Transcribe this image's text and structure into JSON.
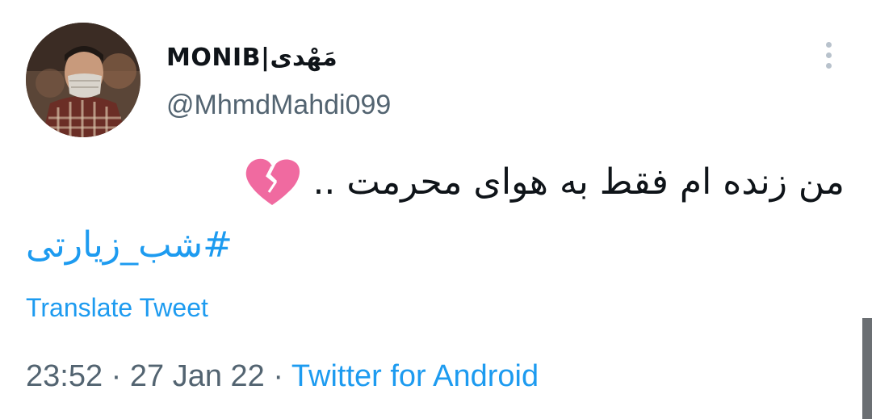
{
  "user": {
    "display_name": "MONIB|مَهْدی",
    "handle": "@MhmdMahdi099"
  },
  "tweet": {
    "text": "من زنده ام فقط به هوای محرمت ..",
    "heart_emoji": "broken-heart-icon",
    "hashtag": "#شب_زیارتی"
  },
  "actions": {
    "translate_label": "Translate Tweet"
  },
  "meta": {
    "time": "23:52",
    "separator": "·",
    "date": "27 Jan 22",
    "source": "Twitter for Android"
  },
  "colors": {
    "link": "#1d9bf0",
    "secondary_text": "#536471",
    "heart": "#f0609a"
  }
}
